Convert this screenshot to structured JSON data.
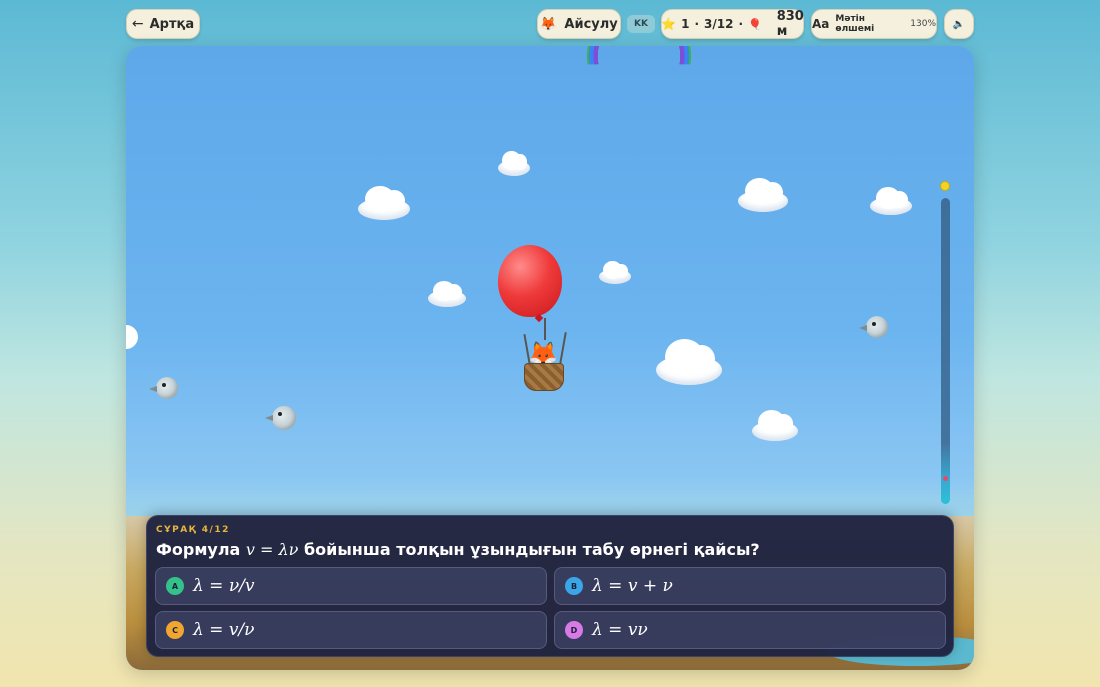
{
  "topbar": {
    "back_label": "Артқа",
    "back_icon": "←",
    "player_name": "Айсулу",
    "player_avatar": "🦊",
    "language_code": "KK",
    "score": {
      "star_icon": "⭐",
      "stars": "1",
      "progress": "3/12",
      "balloon_icon": "🎈",
      "altitude": "830 м"
    },
    "text_size": {
      "icon": "Aa",
      "label": "Мәтін өлшемі",
      "value": "130%"
    },
    "sound_icon": "🔈"
  },
  "game": {
    "player_icon": "🦊",
    "climb_progress": 0.25,
    "colors": {
      "balloon": "#ef3a3a",
      "goal_marker": "#f5d323",
      "track": "#43749f"
    }
  },
  "question": {
    "label": "СҰРАҚ 4/12",
    "text_prefix": "Формула ",
    "formula": "v = λν",
    "text_suffix": " бойынша толқын ұзындығын табу өрнегі қайсы?",
    "options": [
      {
        "letter": "A",
        "formula": "λ = ν/v",
        "color": "#34c18a"
      },
      {
        "letter": "B",
        "formula": "λ = v + ν",
        "color": "#3aa6e8"
      },
      {
        "letter": "C",
        "formula": "λ = v/ν",
        "color": "#f0a630"
      },
      {
        "letter": "D",
        "formula": "λ = vν",
        "color": "#d77ae6"
      }
    ]
  }
}
